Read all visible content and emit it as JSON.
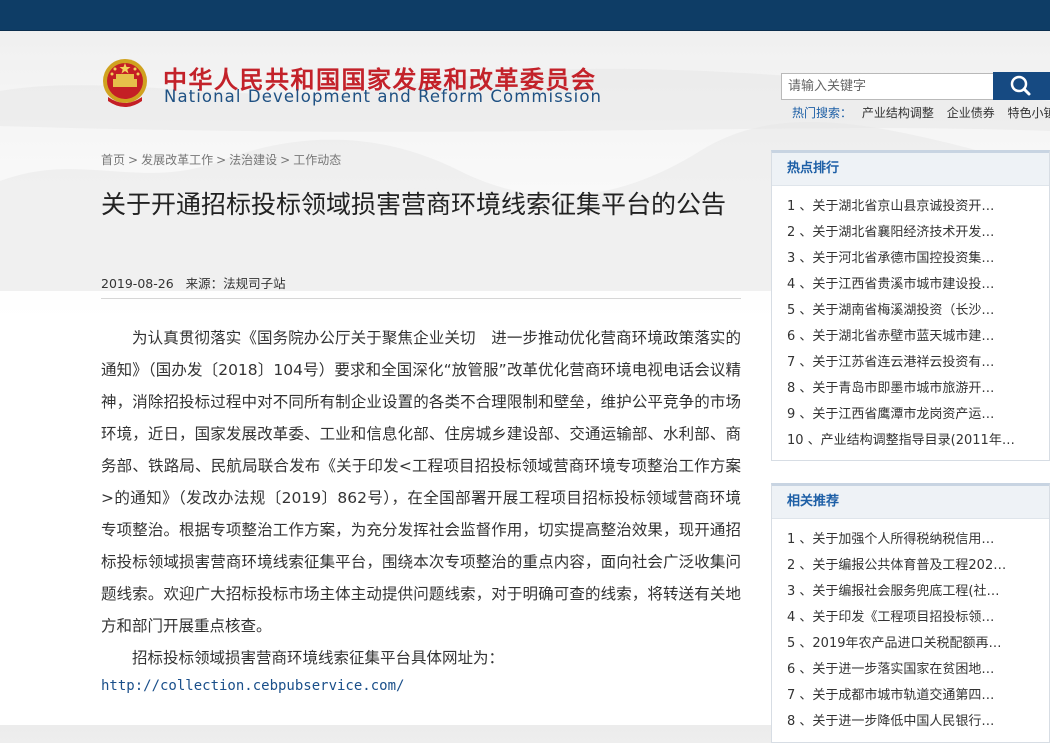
{
  "header": {
    "title_cn": "中华人民共和国国家发展和改革委员会",
    "title_en": "National Development and Reform Commission"
  },
  "search": {
    "placeholder": "请输入关键字",
    "hot_label": "热门搜索：",
    "hot_keywords": [
      "产业结构调整",
      "企业债券",
      "特色小镇"
    ]
  },
  "breadcrumb": [
    "首页",
    "发展改革工作",
    "法治建设",
    "工作动态"
  ],
  "article": {
    "title": "关于开通招标投标领域损害营商环境线索征集平台的公告",
    "date": "2019-08-26",
    "source": "来源：法规司子站",
    "paragraphs": [
      "为认真贯彻落实《国务院办公厅关于聚焦企业关切　进一步推动优化营商环境政策落实的通知》（国办发〔2018〕104号）要求和全国深化“放管服”改革优化营商环境电视电话会议精神，消除招投标过程中对不同所有制企业设置的各类不合理限制和壁垒，维护公平竞争的市场环境，近日，国家发展改革委、工业和信息化部、住房城乡建设部、交通运输部、水利部、商务部、铁路局、民航局联合发布《关于印发<工程项目招投标领域营商环境专项整治工作方案>的通知》（发改办法规〔2019〕862号），在全国部署开展工程项目招标投标领域营商环境专项整治。根据专项整治工作方案，为充分发挥社会监督作用，切实提高整治效果，现开通招标投标领域损害营商环境线索征集平台，围绕本次专项整治的重点内容，面向社会广泛收集问题线索。欢迎广大招标投标市场主体主动提供问题线索，对于明确可查的线索，将转送有关地方和部门开展重点核查。",
      "招标投标领域损害营商环境线索征集平台具体网址为："
    ],
    "url": "http://collection.cebpubservice.com/"
  },
  "hot_ranking": {
    "title": "热点排行",
    "items": [
      "1 、关于湖北省京山县京诚投资开…",
      "2 、关于湖北省襄阳经济技术开发…",
      "3 、关于河北省承德市国控投资集…",
      "4 、关于江西省贵溪市城市建设投…",
      "5 、关于湖南省梅溪湖投资（长沙…",
      "6 、关于湖北省赤壁市蓝天城市建…",
      "7 、关于江苏省连云港祥云投资有…",
      "8 、关于青岛市即墨市城市旅游开…",
      "9 、关于江西省鹰潭市龙岗资产运…",
      "10 、产业结构调整指导目录(2011年…"
    ]
  },
  "related": {
    "title": "相关推荐",
    "items": [
      "1 、关于加强个人所得税纳税信用…",
      "2 、关于编报公共体育普及工程202…",
      "3 、关于编报社会服务兜底工程(社…",
      "4 、关于印发《工程项目招投标领…",
      "5 、2019年农产品进口关税配额再…",
      "6 、关于进一步落实国家在贫困地…",
      "7 、关于成都市城市轨道交通第四…",
      "8 、关于进一步降低中国人民银行…"
    ]
  },
  "colors": {
    "topbar": "#0e3d66",
    "title_red": "#c3222a",
    "brand_blue": "#1f5183",
    "link_blue": "#1d5fa6"
  }
}
